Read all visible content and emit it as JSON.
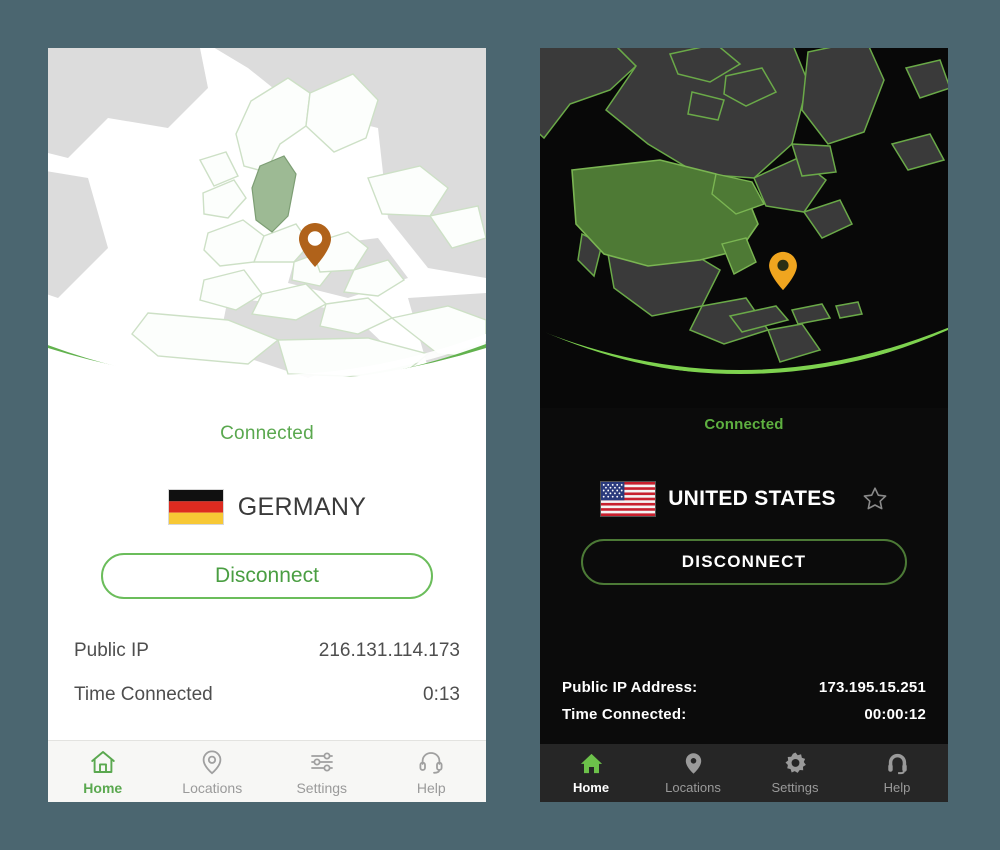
{
  "theme": {
    "page_background": "#4b6670",
    "light_accent_green": "#5aa84f",
    "dark_accent_green": "#5eb040",
    "light_pin_color": "#b0621a",
    "dark_pin_color": "#f0a51f",
    "light_highlight_country": "#9dba94",
    "dark_highlight_country": "#4e7a35"
  },
  "light_app": {
    "status": "Connected",
    "country": "GERMANY",
    "flag": "germany-flag",
    "disconnect_label": "Disconnect",
    "map": {
      "region": "europe-map",
      "highlighted_country": "Germany",
      "pin": "location-pin"
    },
    "info": [
      {
        "label": "Public IP",
        "value": "216.131.114.173"
      },
      {
        "label": "Time Connected",
        "value": "0:13"
      }
    ],
    "nav": [
      {
        "label": "Home",
        "icon": "home-icon",
        "active": true
      },
      {
        "label": "Locations",
        "icon": "location-pin-icon",
        "active": false
      },
      {
        "label": "Settings",
        "icon": "sliders-icon",
        "active": false
      },
      {
        "label": "Help",
        "icon": "headset-icon",
        "active": false
      }
    ]
  },
  "dark_app": {
    "status": "Connected",
    "country": "UNITED STATES",
    "flag": "united-states-flag",
    "favorite_icon": "star-outline-icon",
    "disconnect_label": "DISCONNECT",
    "map": {
      "region": "north-america-map",
      "highlighted_country": "United States",
      "pin": "location-pin"
    },
    "info": [
      {
        "label": "Public IP Address:",
        "value": "173.195.15.251"
      },
      {
        "label": "Time Connected:",
        "value": "00:00:12"
      }
    ],
    "nav": [
      {
        "label": "Home",
        "icon": "home-icon",
        "active": true
      },
      {
        "label": "Locations",
        "icon": "location-pin-icon",
        "active": false
      },
      {
        "label": "Settings",
        "icon": "gear-icon",
        "active": false
      },
      {
        "label": "Help",
        "icon": "headset-icon",
        "active": false
      }
    ]
  }
}
